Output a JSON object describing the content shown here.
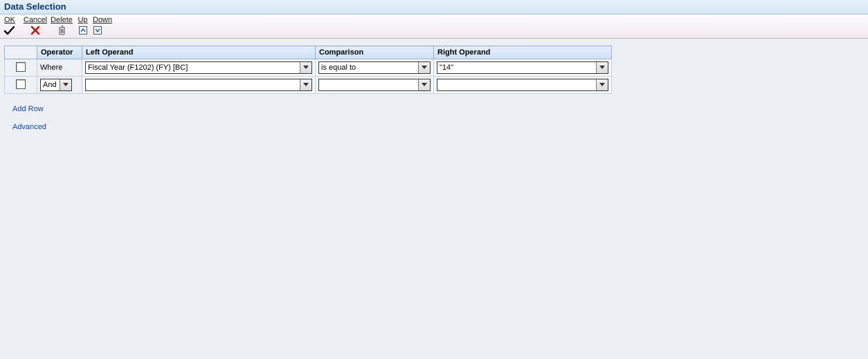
{
  "title": "Data Selection",
  "toolbar": {
    "ok": "OK",
    "cancel": "Cancel",
    "delete": "Delete",
    "up": "Up",
    "down": "Down"
  },
  "columns": {
    "sel": "",
    "operator": "Operator",
    "left": "Left Operand",
    "comparison": "Comparison",
    "right": "Right Operand"
  },
  "rows": [
    {
      "operator_label": "Where",
      "operator_is_dropdown": false,
      "left": "Fiscal Year (F1202) (FY) [BC]",
      "comparison": "is equal to",
      "right": "\"14\""
    },
    {
      "operator_label": "And",
      "operator_is_dropdown": true,
      "left": "",
      "comparison": "",
      "right": ""
    }
  ],
  "links": {
    "add_row": "Add Row",
    "advanced": "Advanced"
  }
}
